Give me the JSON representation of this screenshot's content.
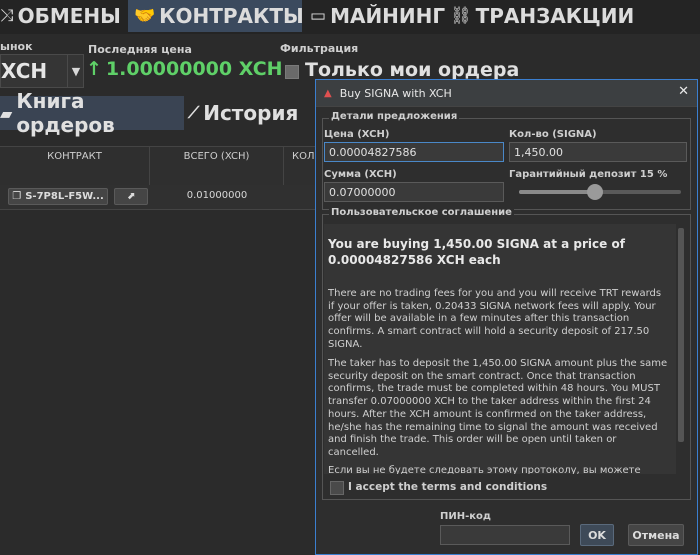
{
  "top_tabs": [
    {
      "label": "ОБМЕНЫ",
      "icon": "shuffle-icon"
    },
    {
      "label": "КОНТРАКТЫ",
      "icon": "handshake-icon"
    },
    {
      "label": "МАЙНИНГ",
      "icon": "hard-drive-icon"
    },
    {
      "label": "ТРАНЗАКЦИИ",
      "icon": "link-icon"
    }
  ],
  "market": {
    "label": "ынок",
    "value": "XCH"
  },
  "last_price": {
    "label": "Последняя цена",
    "value": "1.00000000 XCH"
  },
  "filter": {
    "label": "Фильтрация",
    "checkbox_label": "Только мои ордера"
  },
  "sub_tabs": [
    {
      "label": "Книга ордеров",
      "icon": "book-icon"
    },
    {
      "label": "История",
      "icon": "chart-line-icon"
    }
  ],
  "table": {
    "headers": [
      "КОНТРАКТ",
      "ВСЕГО (XCH)",
      "КОЛ"
    ],
    "rows": [
      {
        "contract": "S-7P8L-F5W...",
        "total": "0.01000000"
      }
    ]
  },
  "dialog": {
    "title": "Buy SIGNA with XCH",
    "offer_details_legend": "Детали предложения",
    "price_label": "Цена (XCH)",
    "price_value": "0.00004827586",
    "qty_label": "Кол-во (SIGNA)",
    "qty_value": "1,450.00",
    "sum_label": "Сумма (XCH)",
    "sum_value": "0.07000000",
    "deposit_label": "Гарантийный депозит 15 %",
    "deposit_percent": 15,
    "agreement_legend": "Пользовательское соглашение",
    "agreement_title": "You are buying 1,450.00 SIGNA at a price of 0.00004827586 XCH each",
    "agreement_p1": "There are no trading fees for you and you will receive TRT rewards if your offer is taken, 0.20433 SIGNA network fees will apply. Your offer will be available in a few minutes after this transaction confirms. A smart contract will hold a security deposit of 217.50 SIGNA.",
    "agreement_p2": "The taker has to deposit the 1,450.00 SIGNA amount plus the same security deposit on the smart contract. Once that transaction confirms, the trade must be completed within 48 hours. You MUST transfer 0.07000000 XCH to the taker address within the first 24 hours. After the XCH amount is confirmed on the taker address, he/she has the remaining time to signal the amount was received and finish the trade. This order will be open until taken or cancelled.",
    "agreement_p3": "Если вы не будете следовать этому протоколу, вы можете",
    "accept_label": "I accept the terms and conditions",
    "pin_label": "ПИН-код",
    "pin_value": "",
    "ok_label": "OK",
    "cancel_label": "Отмена"
  },
  "colors": {
    "price_green": "#5fd068",
    "accent_blue": "#3b7fd0"
  }
}
